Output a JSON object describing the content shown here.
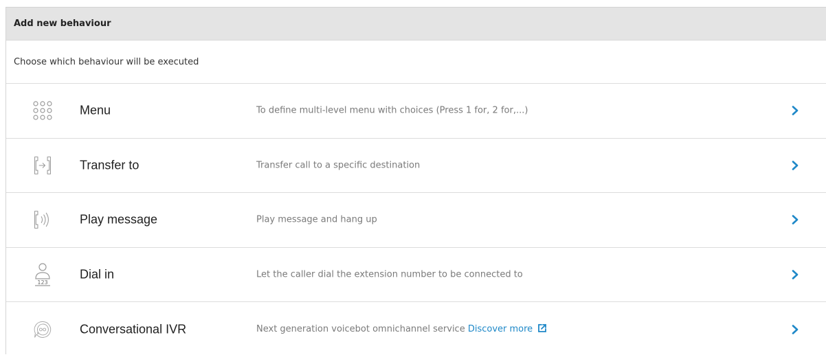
{
  "header": {
    "title": "Add new behaviour"
  },
  "subtitle": "Choose which behaviour will be executed",
  "colors": {
    "accent": "#1e88c8",
    "header_bg": "#e4e4e4",
    "icon": "#9a9a9a"
  },
  "items": [
    {
      "label": "Menu",
      "description": "To define multi-level menu with choices (Press 1 for, 2 for,...)",
      "icon": "keypad-icon"
    },
    {
      "label": "Transfer to",
      "description": "Transfer call to a specific destination",
      "icon": "transfer-call-icon"
    },
    {
      "label": "Play message",
      "description": "Play message and hang up",
      "icon": "play-message-icon"
    },
    {
      "label": "Dial in",
      "description": "Let the caller dial the extension number to be connected to",
      "icon": "dial-in-icon",
      "icon_text": "123"
    },
    {
      "label": "Conversational IVR",
      "description": "Next generation voicebot omnichannel service",
      "link": "Discover more",
      "icon": "chat-bot-icon"
    }
  ]
}
